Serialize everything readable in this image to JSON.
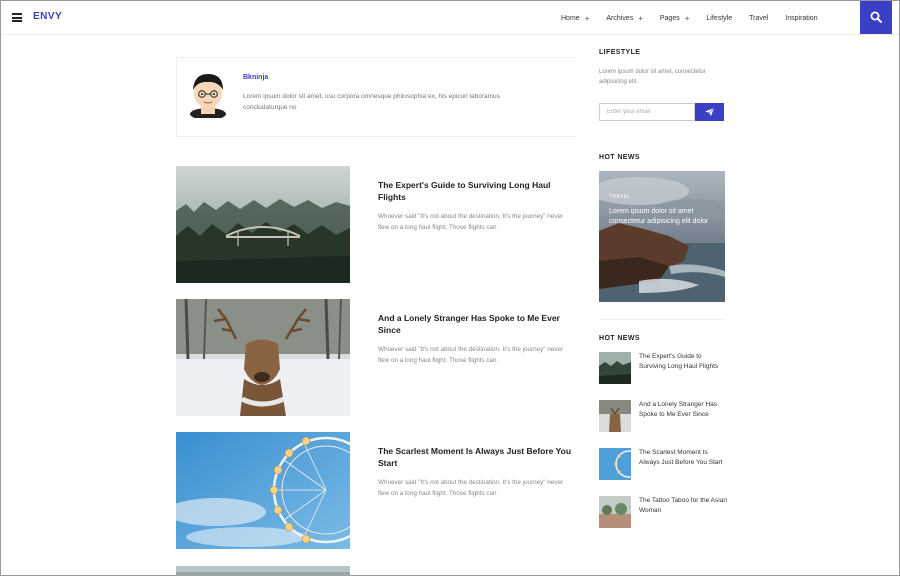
{
  "header": {
    "logo": "ENVY",
    "nav": [
      {
        "label": "Home",
        "has_submenu": true
      },
      {
        "label": "Archives",
        "has_submenu": true
      },
      {
        "label": "Pages",
        "has_submenu": true
      },
      {
        "label": "Lifestyle",
        "has_submenu": false
      },
      {
        "label": "Travel",
        "has_submenu": false
      },
      {
        "label": "Inspiration",
        "has_submenu": false
      }
    ],
    "submenu_symbol": "+"
  },
  "author": {
    "name": "Bkninja",
    "bio": "Lorem ipsum dolor sit amet, usu corpora omnesque philosophia ex, his epicuri laboramus concludaturque no"
  },
  "posts": [
    {
      "title": "The Expert's Guide to Surviving Long Haul Flights",
      "excerpt": "Whoever said \"It's not about the destination. It's the journey\" never flew on a long haul flight. Those flights can"
    },
    {
      "title": "And a Lonely Stranger Has Spoke to Me Ever Since",
      "excerpt": "Whoever said \"It's not about the destination. It's the journey\" never flew on a long haul flight. Those flights can"
    },
    {
      "title": "The Scarlest Moment Is Always Just Before You Start",
      "excerpt": "Whoever said \"It's not about the destination. It's the journey\" never flew on a long haul flight. Those flights can"
    }
  ],
  "sidebar": {
    "newsletter": {
      "heading": "LIFESTYLE",
      "text": "Lorem ipsum dolor sit amet, consectetur adipisicing elit.",
      "email_placeholder": "Enter your email"
    },
    "hot_news_1": {
      "heading": "HOT NEWS",
      "tag": "TRAVEL",
      "title": "Lorem ipsum dolor sit amet consectetur adipisicing elit dolor"
    },
    "hot_news_2": {
      "heading": "HOT NEWS",
      "items": [
        {
          "title": "The Expert's Guide to Surviving Long Haul Flights"
        },
        {
          "title": "And a Lonely Stranger Has Spoke to Me Ever Since"
        },
        {
          "title": "The Scarlest Moment Is Always Just Before You Start"
        },
        {
          "title": "The Tattoo Taboo for the Asian Woman"
        }
      ]
    }
  },
  "colors": {
    "accent": "#3b3fc4"
  }
}
